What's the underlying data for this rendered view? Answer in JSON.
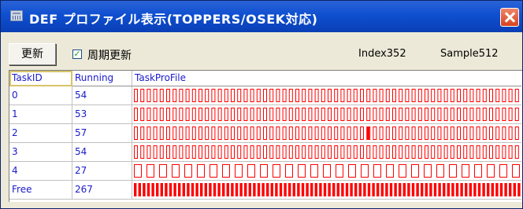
{
  "window": {
    "title": "DEF プロファイル表示(TOPPERS/OSEK対応)"
  },
  "toolbar": {
    "refresh_label": "更新",
    "checkbox_mark": "✓",
    "checkbox_label": "周期更新",
    "checkbox_checked": true,
    "index_text": "Index352",
    "sample_text": "Sample512"
  },
  "table": {
    "columns": [
      "TaskID",
      "Running",
      "TaskProFile"
    ],
    "rows": [
      {
        "task_id": "0",
        "running": "54",
        "profile_pattern": "regular"
      },
      {
        "task_id": "1",
        "running": "53",
        "profile_pattern": "regular"
      },
      {
        "task_id": "2",
        "running": "57",
        "profile_pattern": "regular-with-block"
      },
      {
        "task_id": "3",
        "running": "54",
        "profile_pattern": "regular"
      },
      {
        "task_id": "4",
        "running": "27",
        "profile_pattern": "sparse"
      },
      {
        "task_id": "Free",
        "running": "267",
        "profile_pattern": "dense"
      }
    ]
  },
  "colors": {
    "title_bar": "#0e4fd0",
    "profile_bar": "#ff0000",
    "text_blue": "#1a1acc"
  }
}
